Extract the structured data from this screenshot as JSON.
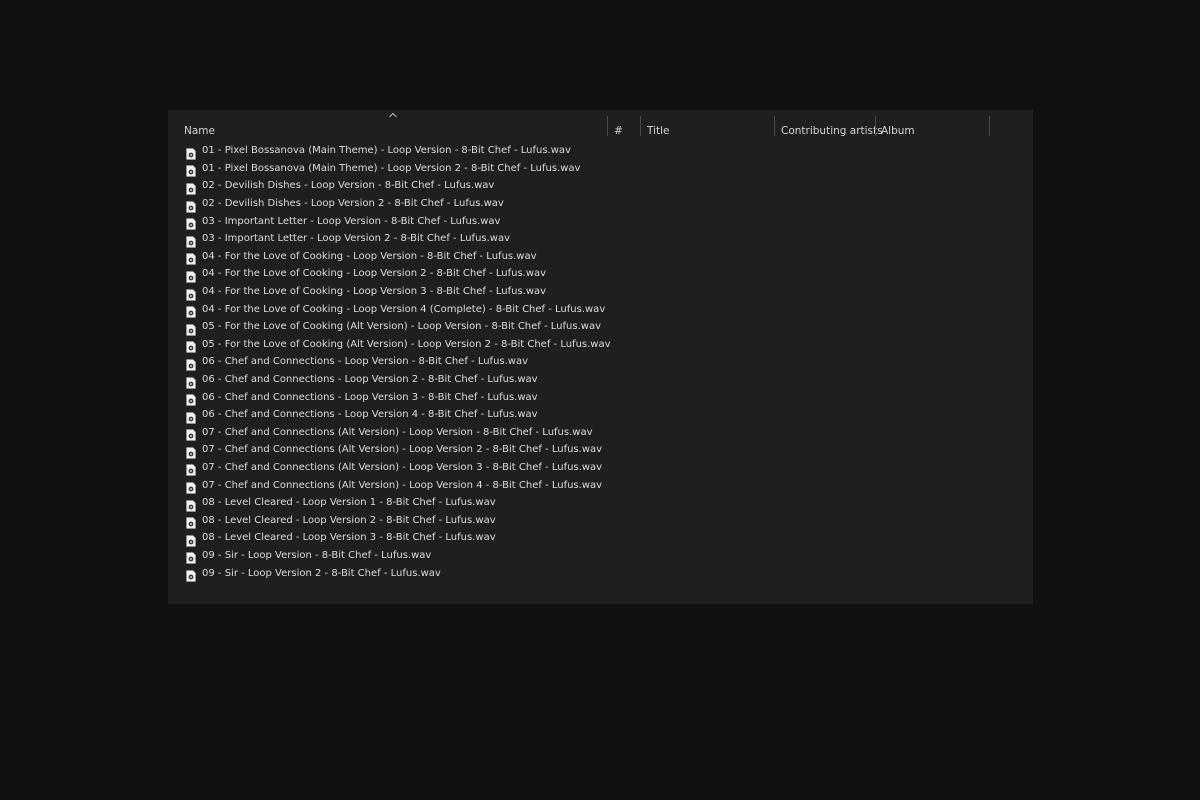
{
  "colors": {
    "background": "#111111",
    "panel": "#1f1f21",
    "text": "#dcdcdc",
    "divider": "#4a4a4a"
  },
  "header": {
    "columns": [
      "Name",
      "#",
      "Title",
      "Contributing artists",
      "Album"
    ],
    "sort_indicator": "ascending"
  },
  "file_icon": "audio-file-icon",
  "files": [
    "01 - Pixel Bossanova (Main Theme) - Loop Version - 8-Bit Chef - Lufus.wav",
    "01 - Pixel Bossanova (Main Theme) - Loop Version 2 - 8-Bit Chef - Lufus.wav",
    "02 - Devilish Dishes - Loop Version - 8-Bit Chef - Lufus.wav",
    "02 - Devilish Dishes - Loop Version 2 - 8-Bit Chef - Lufus.wav",
    "03 - Important Letter - Loop Version - 8-Bit Chef - Lufus.wav",
    "03 - Important Letter - Loop Version 2 - 8-Bit Chef - Lufus.wav",
    "04 - For the Love of Cooking - Loop Version - 8-Bit Chef - Lufus.wav",
    "04 - For the Love of Cooking - Loop Version 2 - 8-Bit Chef - Lufus.wav",
    "04 - For the Love of Cooking - Loop Version 3 - 8-Bit Chef - Lufus.wav",
    "04 - For the Love of Cooking - Loop Version 4 (Complete) - 8-Bit Chef - Lufus.wav",
    "05 - For the Love of Cooking (Alt Version) - Loop Version - 8-Bit Chef - Lufus.wav",
    "05 - For the Love of Cooking (Alt Version) - Loop Version 2 - 8-Bit Chef - Lufus.wav",
    "06 - Chef and Connections - Loop Version - 8-Bit Chef - Lufus.wav",
    "06 - Chef and Connections - Loop Version 2 - 8-Bit Chef - Lufus.wav",
    "06 - Chef and Connections - Loop Version 3 - 8-Bit Chef - Lufus.wav",
    "06 - Chef and Connections - Loop Version 4 - 8-Bit Chef - Lufus.wav",
    "07 - Chef and Connections (Alt Version) - Loop Version - 8-Bit Chef - Lufus.wav",
    "07 - Chef and Connections (Alt Version) - Loop Version 2 - 8-Bit Chef - Lufus.wav",
    "07 - Chef and Connections (Alt Version) - Loop Version 3 - 8-Bit Chef - Lufus.wav",
    "07 - Chef and Connections (Alt Version) - Loop Version 4 - 8-Bit Chef - Lufus.wav",
    "08 - Level Cleared - Loop Version 1 - 8-Bit Chef - Lufus.wav",
    "08 - Level Cleared - Loop Version 2 - 8-Bit Chef - Lufus.wav",
    "08 - Level Cleared - Loop Version 3 - 8-Bit Chef - Lufus.wav",
    "09 - Sir - Loop Version - 8-Bit Chef - Lufus.wav",
    "09 - Sir - Loop Version 2 - 8-Bit Chef - Lufus.wav"
  ]
}
